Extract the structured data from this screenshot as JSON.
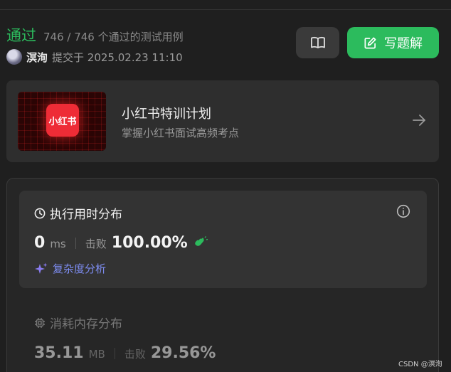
{
  "status": {
    "label": "通过",
    "tests": "746 / 746 个通过的测试用例"
  },
  "submission": {
    "username": "溟洵",
    "submitted_label": "提交于 2025.02.23 11:10"
  },
  "toolbar": {
    "write_solution_label": "写题解"
  },
  "promo": {
    "logo_text": "小红书",
    "title": "小红书特训计划",
    "subtitle": "掌握小红书面试高频考点"
  },
  "runtime": {
    "title": "执行用时分布",
    "value": "0",
    "unit": "ms",
    "beat_label": "击败",
    "beat_percent": "100.00%",
    "complexity_label": "复杂度分析"
  },
  "memory": {
    "title": "消耗内存分布",
    "value": "35.11",
    "unit": "MB",
    "beat_label": "击败",
    "beat_percent": "29.56%"
  },
  "watermark": "CSDN @溟洵",
  "colors": {
    "accent_green": "#2cbb5d",
    "complexity_blue": "#7d8cf0",
    "brand_red": "#ee2c36"
  },
  "icons": {
    "book": "book-icon",
    "edit": "edit-icon",
    "arrow": "arrow-right-icon",
    "clock": "clock-icon",
    "info": "info-icon",
    "clap": "clap-icon",
    "sparkle": "sparkle-icon",
    "chip": "chip-icon"
  }
}
